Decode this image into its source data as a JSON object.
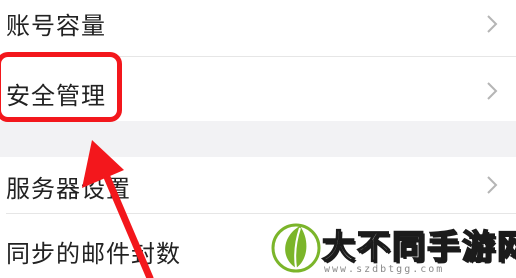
{
  "settings": {
    "items": [
      {
        "label": "账号容量"
      },
      {
        "label": "安全管理"
      },
      {
        "label": "服务器设置"
      },
      {
        "label": "同步的邮件封数"
      }
    ]
  },
  "watermark": {
    "brand": "大不同手游网",
    "url": "www.szdbtgg.com"
  },
  "colors": {
    "highlight": "#f3171c",
    "arrow": "#f3171c",
    "section_gap": "#f2f2f4",
    "logo_green": "#7bb52a"
  }
}
